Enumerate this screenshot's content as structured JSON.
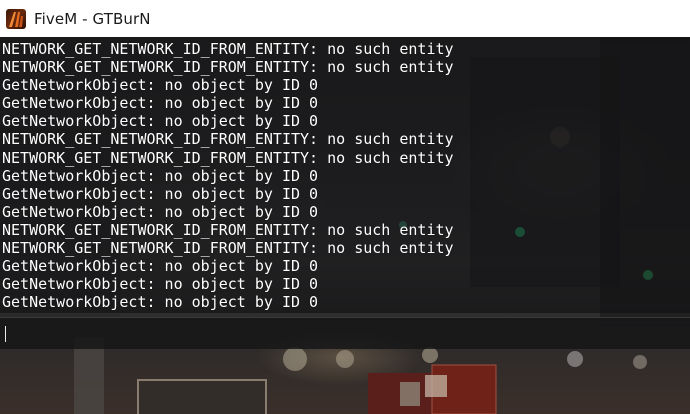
{
  "window": {
    "title": "FiveM - GTBurN",
    "icon": "fivem-app-icon"
  },
  "console": {
    "lines": [
      "NETWORK_GET_NETWORK_ID_FROM_ENTITY: no such entity",
      "NETWORK_GET_NETWORK_ID_FROM_ENTITY: no such entity",
      "GetNetworkObject: no object by ID 0",
      "GetNetworkObject: no object by ID 0",
      "GetNetworkObject: no object by ID 0",
      "NETWORK_GET_NETWORK_ID_FROM_ENTITY: no such entity",
      "NETWORK_GET_NETWORK_ID_FROM_ENTITY: no such entity",
      "GetNetworkObject: no object by ID 0",
      "GetNetworkObject: no object by ID 0",
      "GetNetworkObject: no object by ID 0",
      "NETWORK_GET_NETWORK_ID_FROM_ENTITY: no such entity",
      "NETWORK_GET_NETWORK_ID_FROM_ENTITY: no such entity",
      "GetNetworkObject: no object by ID 0",
      "GetNetworkObject: no object by ID 0",
      "GetNetworkObject: no object by ID 0"
    ],
    "input_value": ""
  },
  "colors": {
    "text": "#ffffff",
    "titlebar": "#ffffff",
    "console_bg": "#101012"
  }
}
